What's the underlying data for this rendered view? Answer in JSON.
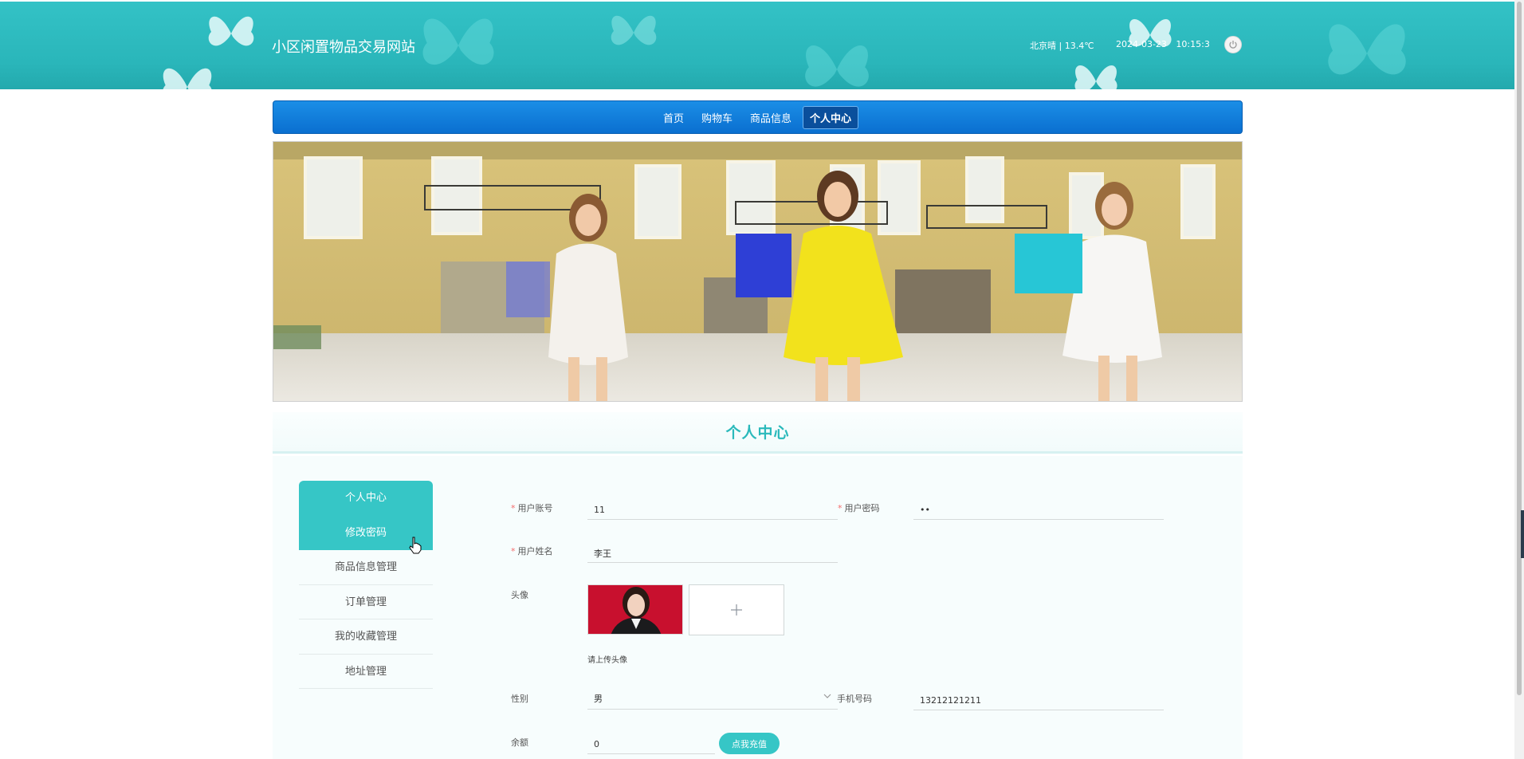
{
  "header": {
    "site_title": "小区闲置物品交易网站",
    "weather": "北京晴 | 13.4℃",
    "datetime": "2024-03-23 10:15:3"
  },
  "nav": {
    "items": [
      {
        "label": "首页"
      },
      {
        "label": "购物车"
      },
      {
        "label": "商品信息"
      },
      {
        "label": "个人中心",
        "active": true
      }
    ]
  },
  "section_title": "个人中心",
  "side_menu": {
    "items": [
      {
        "label": "个人中心",
        "active": true
      },
      {
        "label": "修改密码",
        "active": true
      },
      {
        "label": "商品信息管理"
      },
      {
        "label": "订单管理"
      },
      {
        "label": "我的收藏管理"
      },
      {
        "label": "地址管理"
      }
    ]
  },
  "form": {
    "account": {
      "label": "用户账号",
      "value": "11",
      "required": true
    },
    "password": {
      "label": "用户密码",
      "value": "••",
      "required": true
    },
    "name": {
      "label": "用户姓名",
      "value": "李王",
      "required": true
    },
    "avatar": {
      "label": "头像",
      "hint": "请上传头像"
    },
    "gender": {
      "label": "性别",
      "value": "男"
    },
    "phone": {
      "label": "手机号码",
      "value": "13212121211"
    },
    "balance": {
      "label": "余额",
      "value": "0",
      "recharge_label": "点我充值"
    }
  },
  "colors": {
    "header_teal": "#2ab6ba",
    "nav_blue": "#0a6fd0",
    "accent_teal": "#36c6c6",
    "required_red": "#f56c6c"
  }
}
